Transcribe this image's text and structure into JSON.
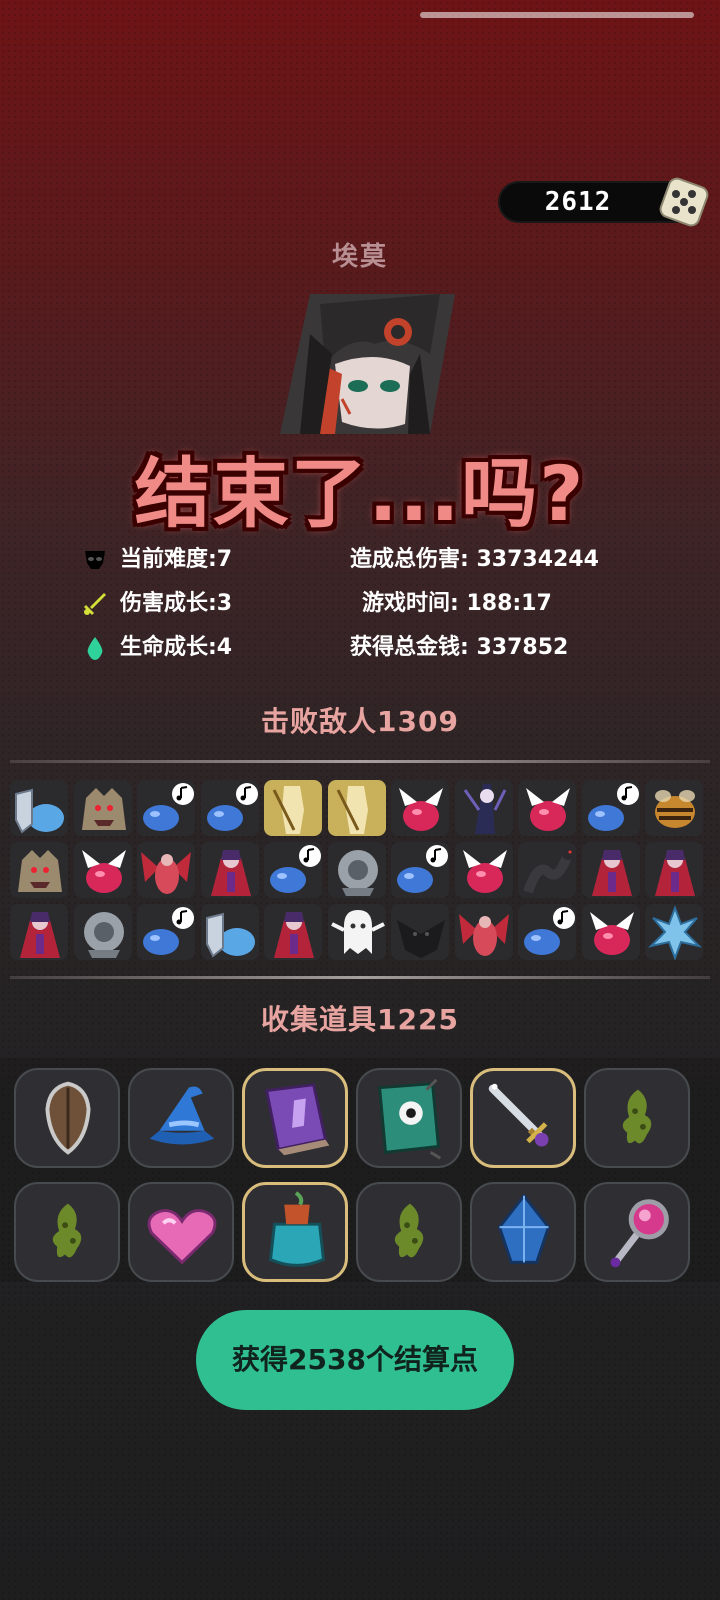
{
  "currency": {
    "amount": "2612",
    "icon": "coin-dice-icon"
  },
  "character": {
    "name": "埃莫"
  },
  "title": "结束了...吗?",
  "stats": {
    "difficulty": {
      "label": "当前难度:7",
      "icon": "skull-icon",
      "color": "#000000"
    },
    "damage_growth": {
      "label": "伤害成长:3",
      "icon": "sword-icon",
      "color": "#d4e03a"
    },
    "life_growth": {
      "label": "生命成长:4",
      "icon": "droplet-icon",
      "color": "#2fd29a"
    },
    "total_damage": {
      "label": "造成总伤害: 33734244"
    },
    "play_time": {
      "label": "游戏时间: 188:17"
    },
    "total_gold": {
      "label": "获得总金钱: 337852"
    }
  },
  "enemies": {
    "title": "击败敌人1309",
    "rows": [
      [
        "shield-slime",
        "werewolf",
        "blue-slime-music",
        "blue-slime-music",
        "gold-knight",
        "gold-knight",
        "red-slime",
        "witch",
        "red-slime",
        "blue-slime-music",
        "bee"
      ],
      [
        "werewolf",
        "red-slime",
        "succubus",
        "vampire-lady",
        "blue-slime-music",
        "armor-golem",
        "blue-slime-music",
        "red-slime",
        "serpent",
        "vampire-lady",
        "vampire-lady"
      ],
      [
        "vampire-lady",
        "armor-golem",
        "blue-slime-music",
        "shield-slime",
        "vampire-lady",
        "ghost",
        "black-bird",
        "succubus",
        "blue-slime-music",
        "red-slime",
        "ice-spirit"
      ]
    ]
  },
  "items": {
    "title": "收集道具1225",
    "rows": [
      [
        {
          "name": "shield-icon",
          "rare": false
        },
        {
          "name": "wizard-hat-icon",
          "rare": false
        },
        {
          "name": "purple-book-icon",
          "rare": true
        },
        {
          "name": "green-book-icon",
          "rare": false
        },
        {
          "name": "sword-icon",
          "rare": true
        },
        {
          "name": "herb-icon",
          "rare": false
        }
      ],
      [
        {
          "name": "herb-icon",
          "rare": false
        },
        {
          "name": "heart-gem-icon",
          "rare": false
        },
        {
          "name": "potion-jar-icon",
          "rare": true
        },
        {
          "name": "herb-icon",
          "rare": false
        },
        {
          "name": "crystal-icon",
          "rare": false
        },
        {
          "name": "orb-staff-icon",
          "rare": false
        }
      ]
    ]
  },
  "claim_button": {
    "label": "获得2538个结算点",
    "color": "#2fbf90"
  }
}
